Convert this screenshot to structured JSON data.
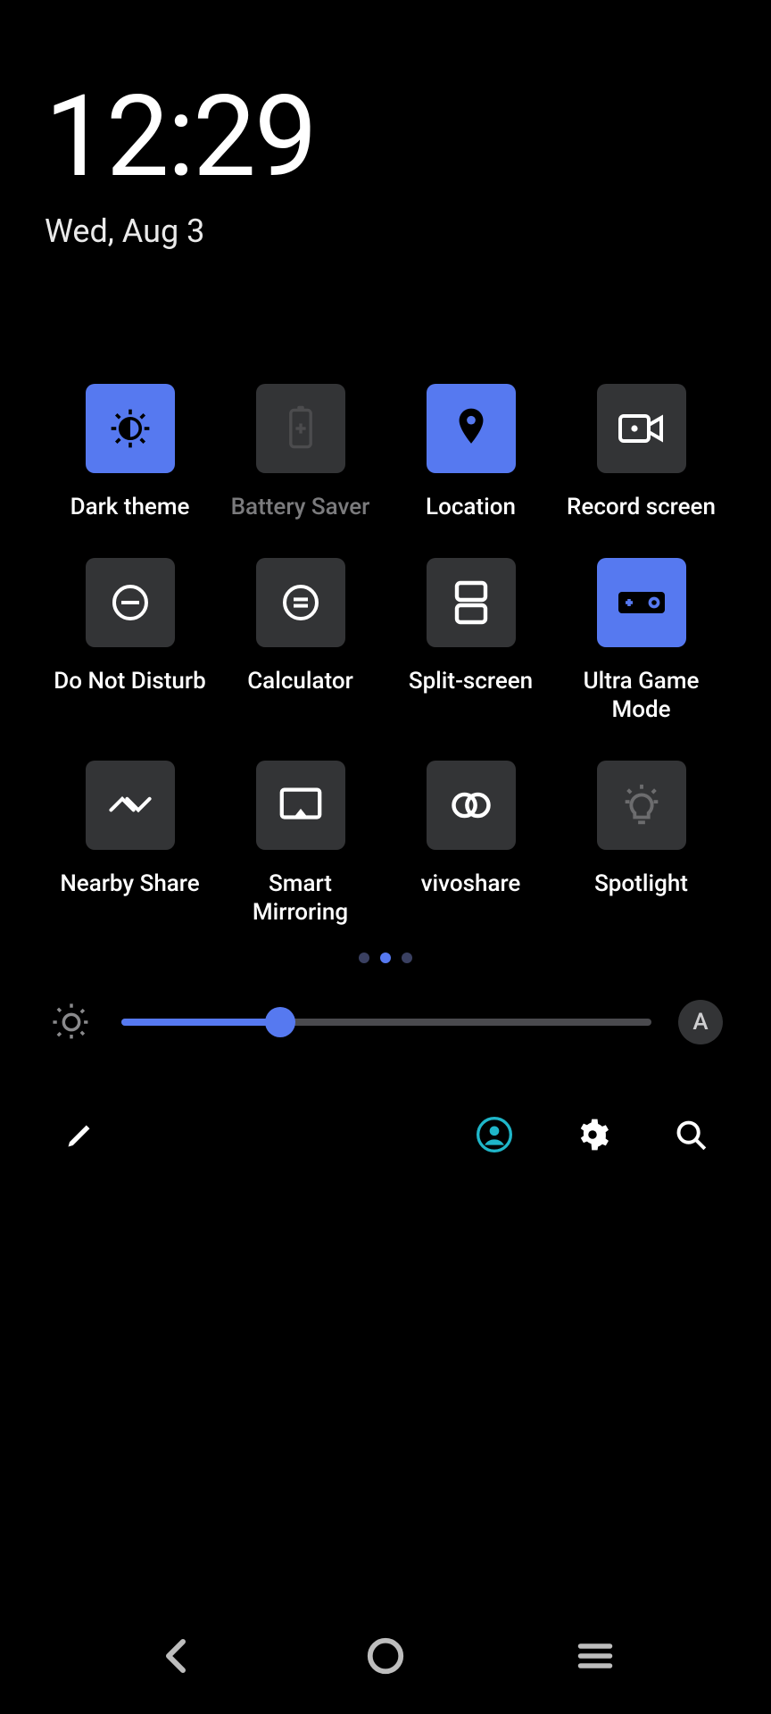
{
  "header": {
    "time": "12:29",
    "date": "Wed, Aug 3"
  },
  "tiles": [
    {
      "id": "dark-theme",
      "label": "Dark theme",
      "active": true,
      "dim": false
    },
    {
      "id": "battery-saver",
      "label": "Battery Saver",
      "active": false,
      "dim": true
    },
    {
      "id": "location",
      "label": "Location",
      "active": true,
      "dim": false
    },
    {
      "id": "record-screen",
      "label": "Record screen",
      "active": false,
      "dim": false
    },
    {
      "id": "dnd",
      "label": "Do Not Disturb",
      "active": false,
      "dim": false
    },
    {
      "id": "calculator",
      "label": "Calculator",
      "active": false,
      "dim": false
    },
    {
      "id": "split-screen",
      "label": "Split-screen",
      "active": false,
      "dim": false
    },
    {
      "id": "ultra-game",
      "label": "Ultra Game Mode",
      "active": true,
      "dim": false
    },
    {
      "id": "nearby-share",
      "label": "Nearby Share",
      "active": false,
      "dim": false
    },
    {
      "id": "smart-mirror",
      "label": "Smart Mirroring",
      "active": false,
      "dim": false
    },
    {
      "id": "vivoshare",
      "label": "vivoshare",
      "active": false,
      "dim": false
    },
    {
      "id": "spotlight",
      "label": "Spotlight",
      "active": false,
      "dim": false
    }
  ],
  "pager": {
    "count": 3,
    "index": 1
  },
  "brightness": {
    "percent": 30,
    "auto_label": "A"
  },
  "colors": {
    "accent": "#5679F0",
    "tile_off": "#333436",
    "user_ring": "#1fb6c9"
  }
}
